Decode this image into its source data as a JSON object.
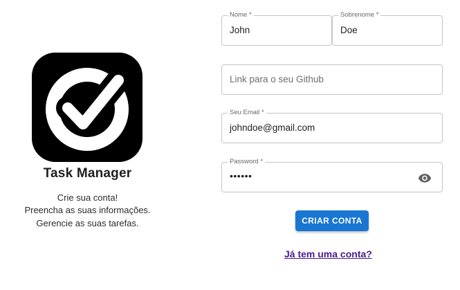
{
  "brand": {
    "app_name": "Task Manager",
    "taglines": [
      "Crie sua conta!",
      "Preencha as suas informações.",
      "Gerencie as suas tarefas."
    ]
  },
  "form": {
    "first_name": {
      "label": "Nome",
      "value": "John"
    },
    "last_name": {
      "label": "Sobrenome",
      "value": "Doe"
    },
    "github": {
      "placeholder": "Link para o seu Github"
    },
    "email": {
      "label": "Seu Email",
      "value": "johndoe@gmail.com"
    },
    "password": {
      "label": "Password",
      "masked_value": "••••••"
    },
    "submit_label": "CRIAR CONTA",
    "login_link": "Já tem uma conta?"
  },
  "colors": {
    "primary": "#1976d2",
    "link": "#4a1a8c",
    "border": "#c4c4c4"
  },
  "icons": {
    "logo": "check-circle-logo",
    "password_toggle": "eye-icon"
  }
}
